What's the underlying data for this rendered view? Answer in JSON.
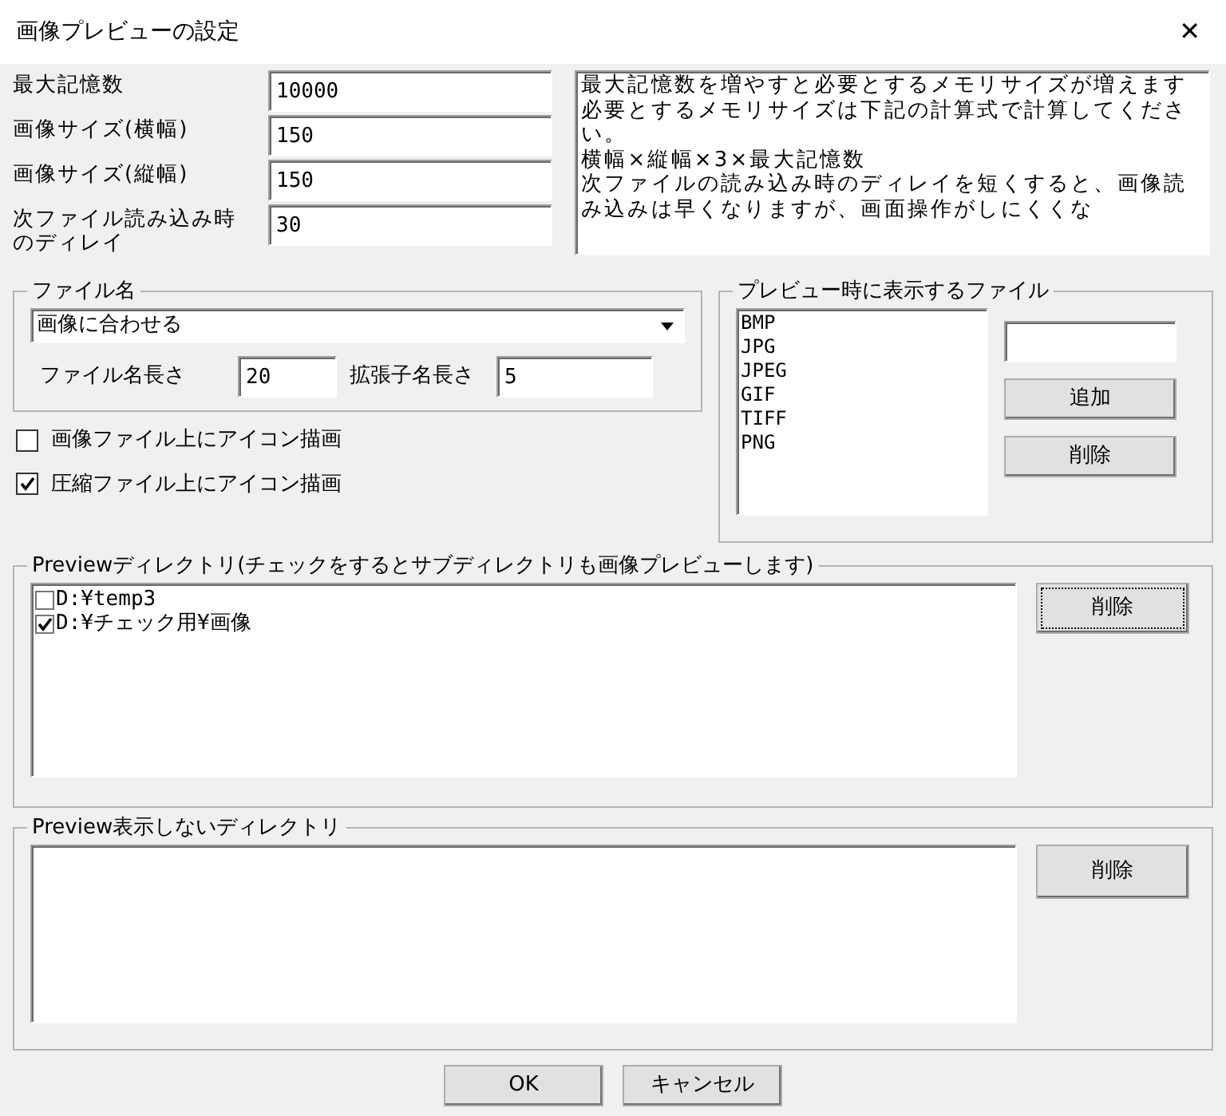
{
  "window": {
    "title": "画像プレビューの設定",
    "close": "✕"
  },
  "settings": [
    {
      "label": "最大記憶数",
      "value": "10000"
    },
    {
      "label": "画像サイズ(横幅)",
      "value": "150"
    },
    {
      "label": "画像サイズ(縦幅)",
      "value": "150"
    },
    {
      "label": "次ファイル読み込み時のディレイ",
      "value": "30"
    }
  ],
  "description": [
    "最大記憶数を増やすと必要とするメモリサイズが増えます",
    "必要とするメモリサイズは下記の計算式で計算してください。",
    "横幅×縦幅×3×最大記憶数",
    "次ファイルの読み込み時のディレイを短くすると、画像読み込みは早くなりますが、画面操作がしにくくな"
  ],
  "filename_group": {
    "title": "ファイル名",
    "dropdown": "画像に合わせる",
    "length_label": "ファイル名長さ",
    "length_value": "20",
    "ext_label": "拡張子名長さ",
    "ext_value": "5"
  },
  "options": [
    {
      "label": "画像ファイル上にアイコン描画",
      "checked": false
    },
    {
      "label": "圧縮ファイル上にアイコン描画",
      "checked": true
    }
  ],
  "preview_files": {
    "title": "プレビュー時に表示するファイル",
    "items": [
      "BMP",
      "JPG",
      "JPEG",
      "GIF",
      "TIFF",
      "PNG"
    ],
    "buttons": [
      "追加",
      "削除"
    ]
  },
  "preview_dirs": {
    "title": "Previewディレクトリ(チェックをするとサブディレクトリも画像プレビューします)",
    "items": [
      {
        "path": "D:¥temp3",
        "checked": false
      },
      {
        "path": "D:¥チェック用¥画像",
        "checked": true
      }
    ],
    "button": "削除"
  },
  "excluded_dirs": {
    "title": "Preview表示しないディレクトリ",
    "button": "削除"
  },
  "buttons": [
    "OK",
    "キャンセル"
  ]
}
